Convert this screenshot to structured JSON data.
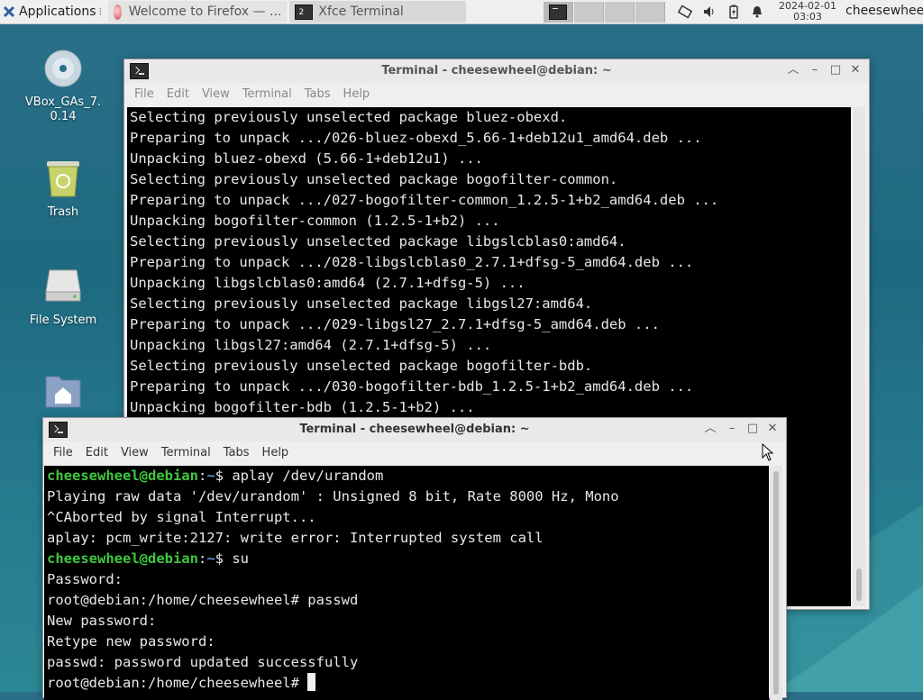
{
  "panel": {
    "applications_label": "Applications",
    "tasks": [
      {
        "label": "Welcome to Firefox — ...",
        "icon": "firefox-icon"
      },
      {
        "label": "Xfce Terminal",
        "icon": "terminal-icon",
        "count": "2"
      }
    ],
    "clock_date": "2024-02-01",
    "clock_time": "03:03",
    "user": "cheesewheel",
    "tray_icons": [
      "network-icon",
      "volume-icon",
      "battery-icon",
      "notification-bell-icon"
    ]
  },
  "desktop": {
    "icons": [
      {
        "label": "VBox_GAs_7.\n0.14",
        "icon": "cd-disc-icon"
      },
      {
        "label": "Trash",
        "icon": "trash-icon"
      },
      {
        "label": "File System",
        "icon": "drive-icon"
      },
      {
        "label": "",
        "icon": "home-folder-icon"
      }
    ]
  },
  "back_window": {
    "title": "Terminal - cheesewheel@debian: ~",
    "menu": [
      "File",
      "Edit",
      "View",
      "Terminal",
      "Tabs",
      "Help"
    ],
    "lines": [
      "Selecting previously unselected package bluez-obexd.",
      "Preparing to unpack .../026-bluez-obexd_5.66-1+deb12u1_amd64.deb ...",
      "Unpacking bluez-obexd (5.66-1+deb12u1) ...",
      "Selecting previously unselected package bogofilter-common.",
      "Preparing to unpack .../027-bogofilter-common_1.2.5-1+b2_amd64.deb ...",
      "Unpacking bogofilter-common (1.2.5-1+b2) ...",
      "Selecting previously unselected package libgslcblas0:amd64.",
      "Preparing to unpack .../028-libgslcblas0_2.7.1+dfsg-5_amd64.deb ...",
      "Unpacking libgslcblas0:amd64 (2.7.1+dfsg-5) ...",
      "Selecting previously unselected package libgsl27:amd64.",
      "Preparing to unpack .../029-libgsl27_2.7.1+dfsg-5_amd64.deb ...",
      "Unpacking libgsl27:amd64 (2.7.1+dfsg-5) ...",
      "Selecting previously unselected package bogofilter-bdb.",
      "Preparing to unpack .../030-bogofilter-bdb_1.2.5-1+b2_amd64.deb ...",
      "Unpacking bogofilter-bdb (1.2.5-1+b2) ..."
    ],
    "tail_fragment": "...]"
  },
  "front_window": {
    "title": "Terminal - cheesewheel@debian: ~",
    "menu": [
      "File",
      "Edit",
      "View",
      "Terminal",
      "Tabs",
      "Help"
    ],
    "prompt_user": "cheesewheel@debian",
    "prompt_path": "~",
    "prompt_sign": "$",
    "lines": [
      {
        "prompt": true,
        "cmd": " aplay /dev/urandom"
      },
      {
        "text": "Playing raw data '/dev/urandom' : Unsigned 8 bit, Rate 8000 Hz, Mono"
      },
      {
        "text": "^CAborted by signal Interrupt..."
      },
      {
        "text": "aplay: pcm_write:2127: write error: Interrupted system call"
      },
      {
        "prompt": true,
        "cmd": " su"
      },
      {
        "text": "Password:"
      },
      {
        "text": "root@debian:/home/cheesewheel# passwd"
      },
      {
        "text": "New password:"
      },
      {
        "text": "Retype new password:"
      },
      {
        "text": "passwd: password updated successfully"
      },
      {
        "text": "root@debian:/home/cheesewheel# ",
        "cursor": true
      }
    ]
  }
}
